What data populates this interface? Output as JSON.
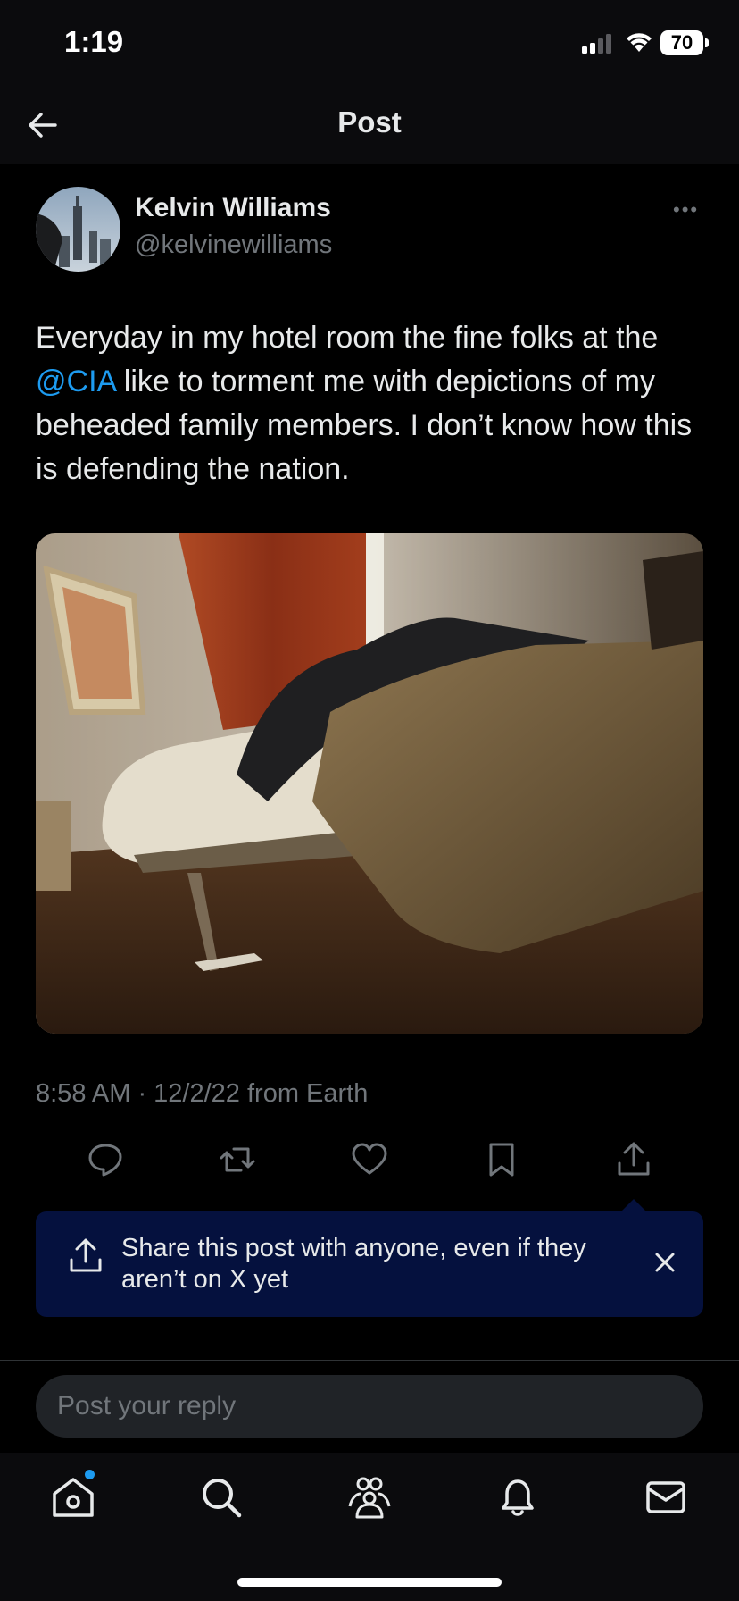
{
  "status_bar": {
    "time": "1:19",
    "battery": "70"
  },
  "header": {
    "title": "Post"
  },
  "author": {
    "name": "Kelvin Williams",
    "handle": "@kelvinewilliams"
  },
  "post": {
    "text_before": "Everyday in my hotel room the fine folks at the ",
    "mention": "@CIA",
    "text_after": " like to torment me with depictions of my beheaded family members. I don’t know how this is defending the nation.",
    "meta": "8:58 AM · 12/2/22 from Earth"
  },
  "actions": [
    "reply-icon",
    "repost-icon",
    "like-icon",
    "bookmark-icon",
    "share-icon"
  ],
  "share_banner": {
    "text": "Share this post with anyone, even if they aren’t on X yet"
  },
  "reply_box": {
    "placeholder": "Post your reply"
  },
  "tabs": [
    "home-icon",
    "search-icon",
    "communities-icon",
    "notifications-icon",
    "messages-icon"
  ],
  "colors": {
    "accent": "#1d9bf0",
    "banner": "#05113e",
    "muted": "#71767b"
  }
}
